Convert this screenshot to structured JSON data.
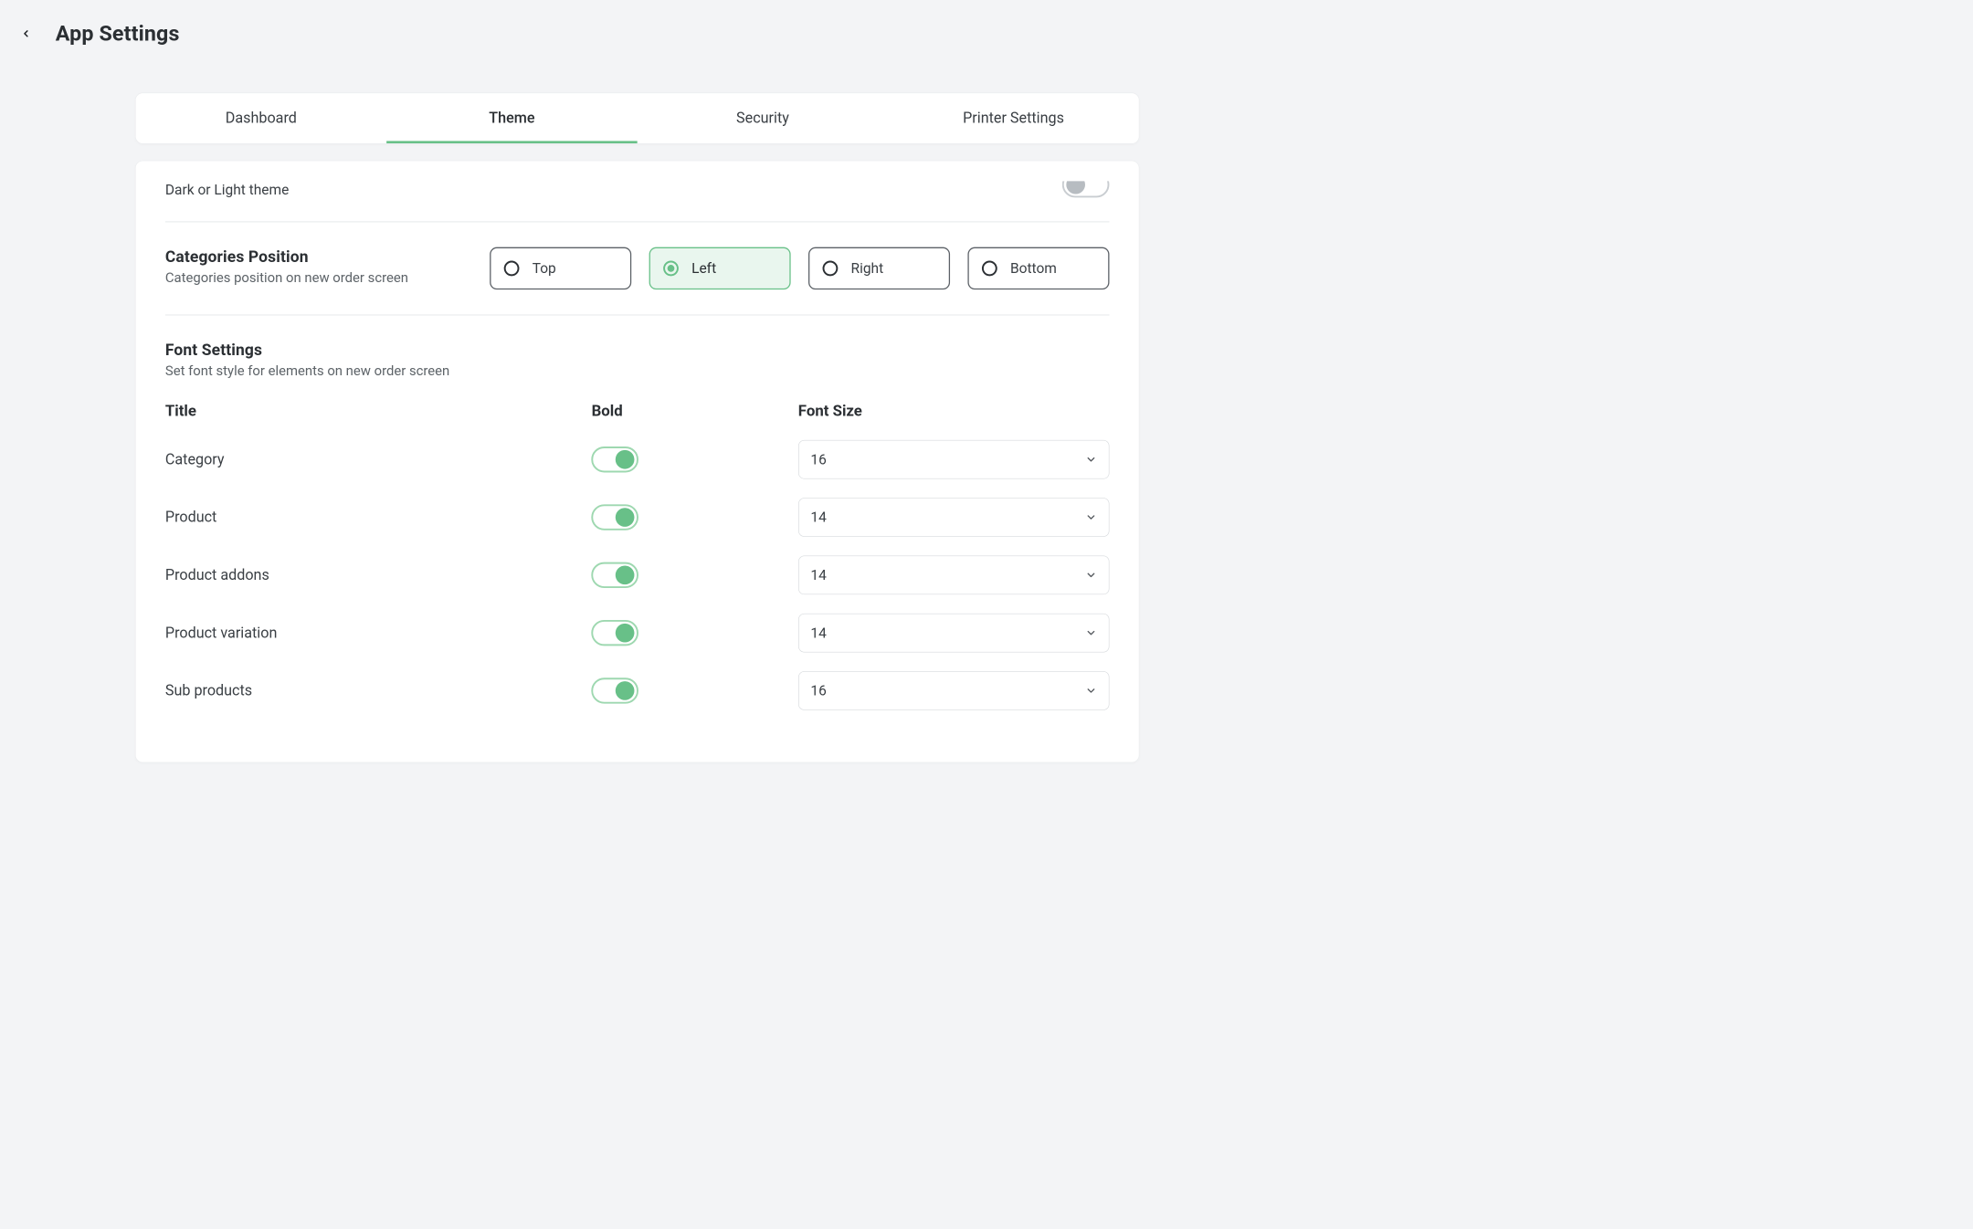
{
  "colors": {
    "accent": "#68c088"
  },
  "header": {
    "title": "App Settings"
  },
  "tabs": [
    {
      "id": "dashboard",
      "label": "Dashboard",
      "active": false
    },
    {
      "id": "theme",
      "label": "Theme",
      "active": true
    },
    {
      "id": "security",
      "label": "Security",
      "active": false
    },
    {
      "id": "printer",
      "label": "Printer Settings",
      "active": false
    }
  ],
  "theme_mode": {
    "label": "Dark or Light theme",
    "toggle_on": false
  },
  "categories_position": {
    "title": "Categories Position",
    "subtitle": "Categories position on new order screen",
    "options": [
      {
        "id": "top",
        "label": "Top",
        "selected": false
      },
      {
        "id": "left",
        "label": "Left",
        "selected": true
      },
      {
        "id": "right",
        "label": "Right",
        "selected": false
      },
      {
        "id": "bottom",
        "label": "Bottom",
        "selected": false
      }
    ]
  },
  "font_settings": {
    "title": "Font Settings",
    "subtitle": "Set font style for elements on new order screen",
    "columns": {
      "title": "Title",
      "bold": "Bold",
      "size": "Font Size"
    },
    "rows": [
      {
        "id": "category",
        "title": "Category",
        "bold": true,
        "size": "16"
      },
      {
        "id": "product",
        "title": "Product",
        "bold": true,
        "size": "14"
      },
      {
        "id": "product_addons",
        "title": "Product addons",
        "bold": true,
        "size": "14"
      },
      {
        "id": "product_variation",
        "title": "Product variation",
        "bold": true,
        "size": "14"
      },
      {
        "id": "sub_products",
        "title": "Sub products",
        "bold": true,
        "size": "16"
      }
    ]
  }
}
